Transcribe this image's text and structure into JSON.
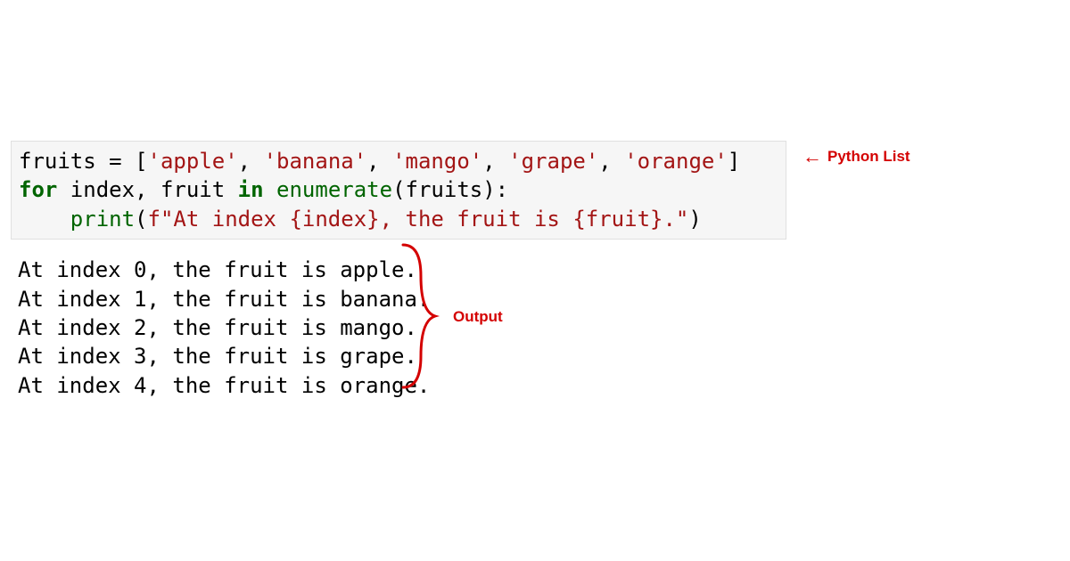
{
  "code": {
    "varName": "fruits",
    "assignOp": " = ",
    "listOpen": "[",
    "listClose": "]",
    "items": [
      "'apple'",
      "'banana'",
      "'mango'",
      "'grape'",
      "'orange'"
    ],
    "sep": ", ",
    "forKw": "for",
    "loopVars": " index, fruit ",
    "inKw": "in",
    "space": " ",
    "enumName": "enumerate",
    "enumArgsOpen": "(",
    "enumArg": "fruits",
    "enumArgsClose": "):",
    "indent": "    ",
    "printName": "print",
    "printOpen": "(",
    "fPrefix": "f",
    "fString": "\"At index {index}, the fruit is {fruit}.\"",
    "printClose": ")"
  },
  "output": [
    "At index 0, the fruit is apple.",
    "At index 1, the fruit is banana.",
    "At index 2, the fruit is mango.",
    "At index 3, the fruit is grape.",
    "At index 4, the fruit is orange."
  ],
  "annotations": {
    "pythonList": "Python List",
    "output": "Output"
  },
  "colors": {
    "annotation": "#d40000",
    "codeBg": "#f6f6f6",
    "keyword": "#006400",
    "string": "#a31515"
  }
}
